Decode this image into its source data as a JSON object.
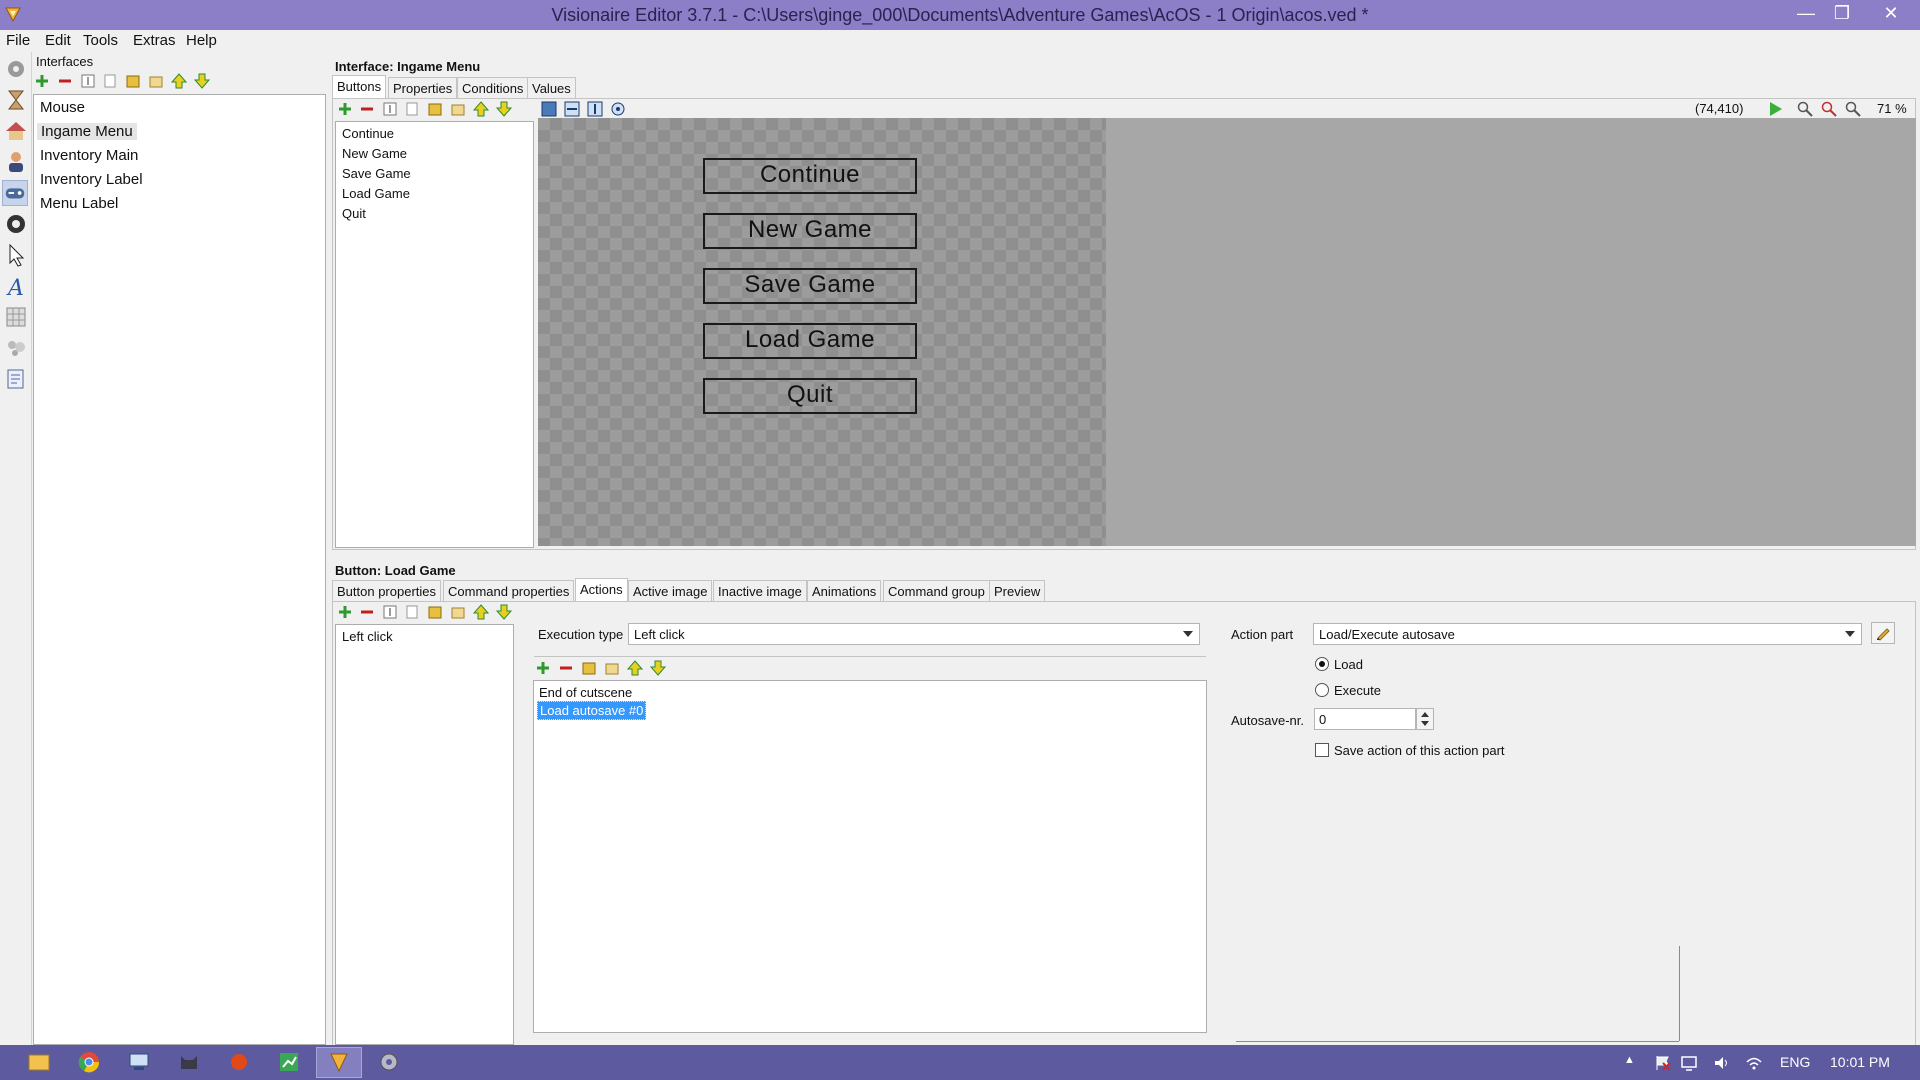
{
  "window": {
    "title": "Visionaire Editor 3.7.1 - C:\\Users\\ginge_000\\Documents\\Adventure Games\\AcOS - 1 Origin\\acos.ved *",
    "minimize": "—",
    "maximize": "❐",
    "close": "✕"
  },
  "menu": [
    "File",
    "Edit",
    "Tools",
    "Extras",
    "Help"
  ],
  "interfaces": {
    "label": "Interfaces",
    "items": [
      "Mouse",
      "Ingame Menu",
      "Inventory Main",
      "Inventory Label",
      "Menu Label"
    ],
    "selected": "Ingame Menu"
  },
  "interface_panel": {
    "title": "Interface: Ingame Menu",
    "tabs": [
      "Buttons",
      "Properties",
      "Conditions",
      "Values"
    ],
    "active_tab": "Buttons",
    "buttons": [
      "Continue",
      "New Game",
      "Save Game",
      "Load Game",
      "Quit"
    ],
    "coords": "(74,410)",
    "zoom": "71 %",
    "canvas_buttons": [
      "Continue",
      "New Game",
      "Save Game",
      "Load Game",
      "Quit"
    ]
  },
  "button_panel": {
    "title": "Button: Load Game",
    "tabs": [
      "Button properties",
      "Command properties",
      "Actions",
      "Active image",
      "Inactive image",
      "Animations",
      "Command group",
      "Preview"
    ],
    "active_tab": "Actions",
    "actions": [
      "Left click"
    ],
    "execution_type_label": "Execution type",
    "execution_type_value": "Left click",
    "action_parts": [
      "End of cutscene",
      "Load autosave #0"
    ],
    "selected_action_part": "Load autosave #0",
    "action_part_label": "Action part",
    "action_part_value": "Load/Execute autosave",
    "radio_load": "Load",
    "radio_execute": "Execute",
    "autosave_label": "Autosave-nr.",
    "autosave_value": "0",
    "save_action_label": "Save action of this action part"
  },
  "tray": {
    "lang": "ENG",
    "time": "10:01 PM"
  },
  "colors": {
    "titlebar": "#8c7ec7",
    "taskbar": "#5e5aa0",
    "selection": "#3399ff"
  }
}
